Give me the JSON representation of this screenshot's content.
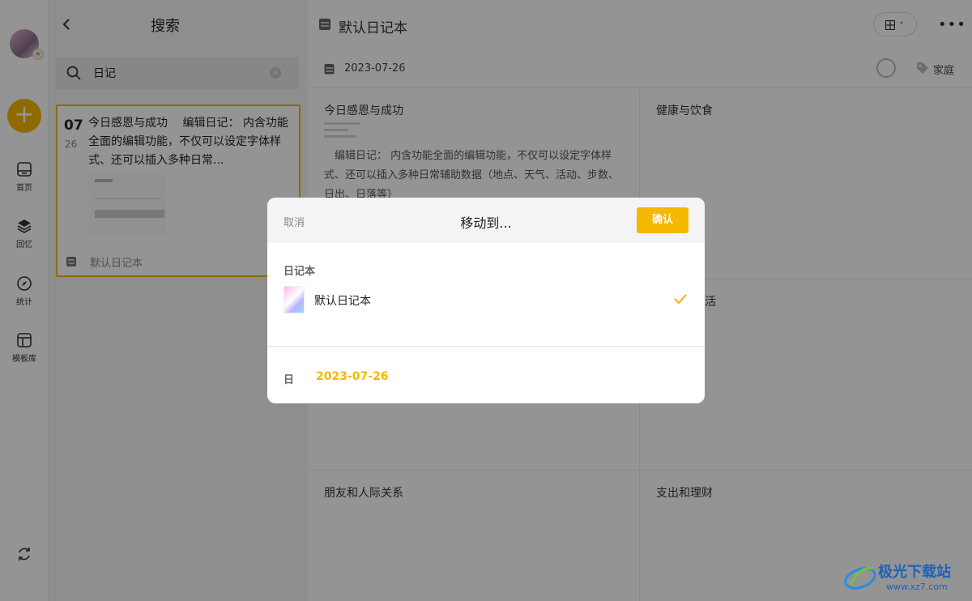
{
  "rail": {
    "items": [
      {
        "label": "首页",
        "icon": "home-icon"
      },
      {
        "label": "回忆",
        "icon": "layers-icon"
      },
      {
        "label": "统计",
        "icon": "compass-icon"
      },
      {
        "label": "模板库",
        "icon": "template-icon"
      }
    ],
    "add_label": "+"
  },
  "search": {
    "title": "搜索",
    "query": "日记",
    "clear_label": "×",
    "result": {
      "day": "07",
      "month": "26",
      "text": "今日感恩与成功　 编辑日记： 内含功能全面的编辑功能，不仅可以设定字体样式、还可以插入多种日常...",
      "notebook": "默认日记本"
    }
  },
  "header": {
    "notebook_title": "默认日记本",
    "more_label": "•••",
    "caret": "▾"
  },
  "main": {
    "date": "2023-07-26",
    "tag": "家庭",
    "cells": [
      {
        "title": "今日感恩与成功",
        "body": "　编辑日记： 内含功能全面的编辑功能，不仅可以设定字体样式、还可以插入多种日常辅助数据（地点、天气、活动、步数、日出、日落等）"
      },
      {
        "title": "健康与饮食",
        "body": ""
      },
      {
        "title": "",
        "body": ""
      },
      {
        "title": "活",
        "body": ""
      },
      {
        "title": "朋友和人际关系",
        "body": ""
      },
      {
        "title": "支出和理财",
        "body": ""
      }
    ]
  },
  "dialog": {
    "cancel": "取消",
    "title": "移动到...",
    "confirm": "确认",
    "section_label": "日记本",
    "notebook_name": "默认日记本",
    "day_label": "日",
    "day_value": "2023-07-26"
  },
  "watermark": {
    "title": "极光下载站",
    "url": "www.xz7.com"
  },
  "colors": {
    "accent": "#f5b800",
    "overlay": "rgba(0,0,0,0.42)"
  }
}
